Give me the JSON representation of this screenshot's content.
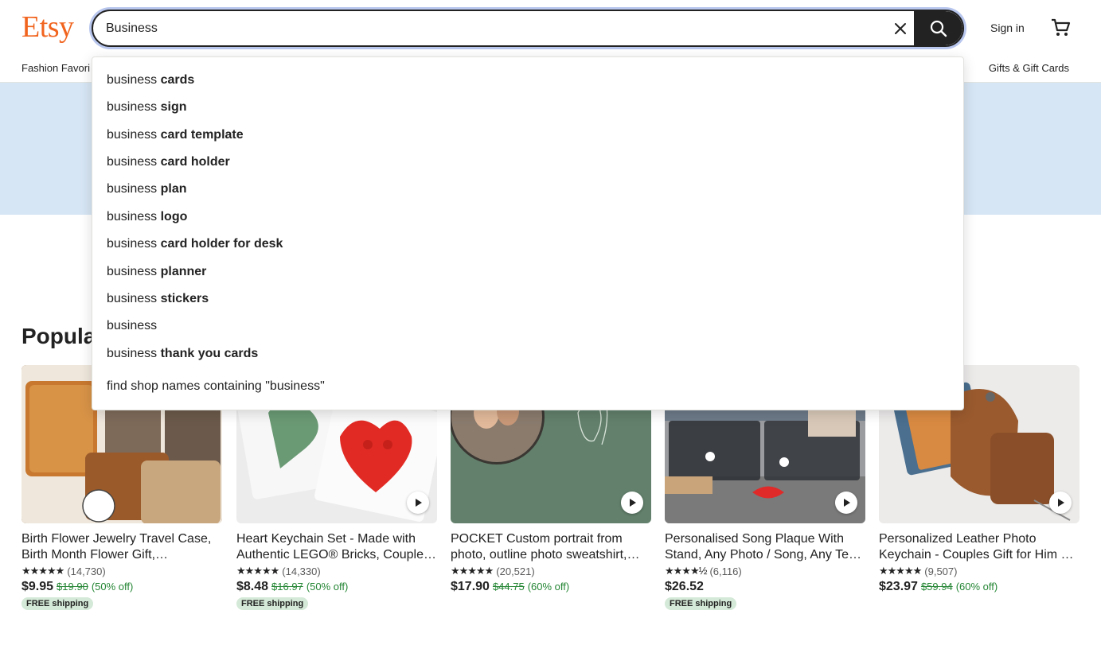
{
  "header": {
    "logo": "Etsy",
    "search_value": "Business",
    "signin": "Sign in"
  },
  "nav": {
    "left_item": "Fashion Favori",
    "right_item": "Gifts & Gift Cards"
  },
  "section": {
    "popular_title": "Popula"
  },
  "suggestions": {
    "items": [
      {
        "prefix": "business",
        "rest": " cards"
      },
      {
        "prefix": "business",
        "rest": " sign"
      },
      {
        "prefix": "business",
        "rest": " card template"
      },
      {
        "prefix": "business",
        "rest": " card holder"
      },
      {
        "prefix": "business",
        "rest": " plan"
      },
      {
        "prefix": "business",
        "rest": " logo"
      },
      {
        "prefix": "business",
        "rest": " card holder for desk"
      },
      {
        "prefix": "business",
        "rest": " planner"
      },
      {
        "prefix": "business",
        "rest": " stickers"
      },
      {
        "prefix": "business",
        "rest": ""
      },
      {
        "prefix": "business",
        "rest": " thank you cards"
      }
    ],
    "shop_find": "find shop names containing \"business\""
  },
  "listings": [
    {
      "title": "Birth Flower Jewelry Travel Case, Birth Month Flower Gift, Personalized Jewelry Box",
      "stars": "★★★★★",
      "reviews": "(14,730)",
      "price": "$9.95",
      "orig": "$19.90",
      "off": "(50% off)",
      "free": "FREE shipping",
      "img_bg": "#8a5a2b"
    },
    {
      "title": "Heart Keychain Set - Made with Authentic LEGO® Bricks, Couples Gift",
      "stars": "★★★★★",
      "reviews": "(14,330)",
      "price": "$8.48",
      "orig": "$16.97",
      "off": "(50% off)",
      "free": "FREE shipping",
      "img_bg": "#e9e9e9"
    },
    {
      "title": "POCKET Custom portrait from photo, outline photo sweatshirt, couple gift",
      "stars": "★★★★★",
      "reviews": "(20,521)",
      "price": "$17.90",
      "orig": "$44.75",
      "off": "(60% off)",
      "free": "",
      "img_bg": "#5f7a68"
    },
    {
      "title": "Personalised Song Plaque With Stand, Any Photo / Song, Any Text Gift",
      "stars": "★★★★½",
      "reviews": "(6,116)",
      "price": "$26.52",
      "orig": "",
      "off": "",
      "free": "FREE shipping",
      "img_bg": "#8d8f93"
    },
    {
      "title": "Personalized Leather Photo Keychain - Couples Gift for Him or Her",
      "stars": "★★★★★",
      "reviews": "(9,507)",
      "price": "$23.97",
      "orig": "$59.94",
      "off": "(60% off)",
      "free": "",
      "img_bg": "#ecebea"
    }
  ]
}
